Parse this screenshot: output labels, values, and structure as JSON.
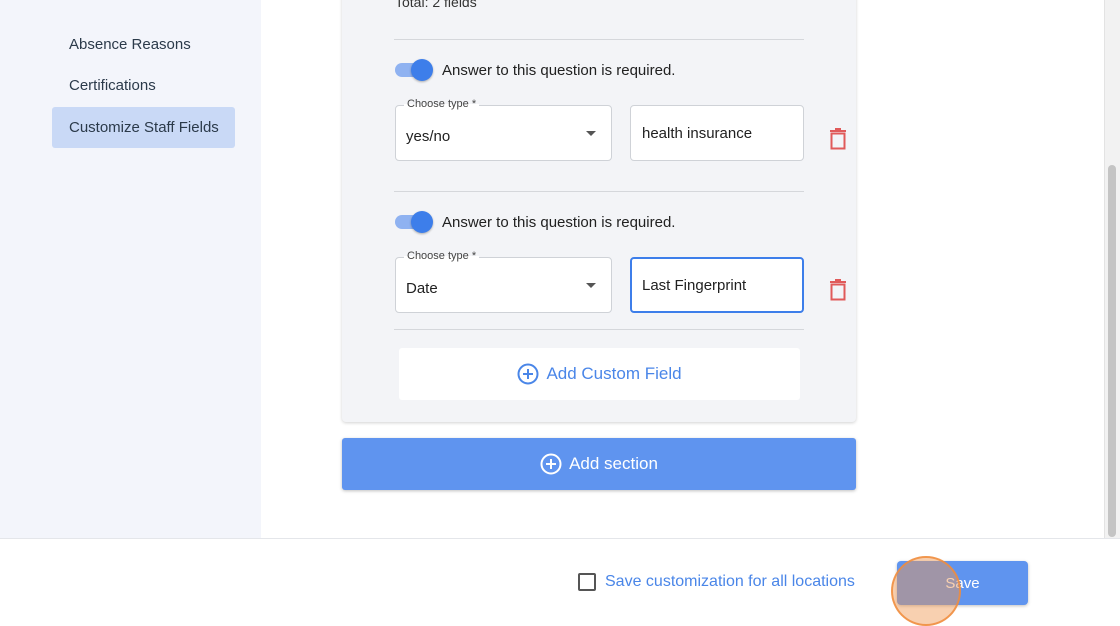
{
  "sidebar": {
    "items": [
      {
        "label": "Absence Reasons",
        "active": false
      },
      {
        "label": "Certifications",
        "active": false
      },
      {
        "label": "Customize Staff Fields",
        "active": true
      }
    ]
  },
  "section": {
    "total_text": "Total: 2 fields",
    "fields": [
      {
        "required_label": "Answer to this question is required.",
        "required": true,
        "type_label": "Choose type *",
        "type_value": "yes/no",
        "name_value": "health insurance",
        "focused": false
      },
      {
        "required_label": "Answer to this question is required.",
        "required": true,
        "type_label": "Choose type *",
        "type_value": "Date",
        "name_value": "Last Fingerprint",
        "focused": true
      }
    ],
    "add_field_label": "Add Custom Field"
  },
  "add_section_label": "Add section",
  "footer": {
    "save_all_label": "Save customization for all locations",
    "save_all_checked": false,
    "save_label": "Save"
  },
  "colors": {
    "accent": "#4a86e8",
    "primary_button": "#5f94ef",
    "active_sidebar": "#c9d9f6",
    "delete": "#e05a5a"
  },
  "icons": {
    "delete": "trash-icon",
    "add": "plus-circle-icon",
    "dropdown": "caret-down-icon"
  }
}
